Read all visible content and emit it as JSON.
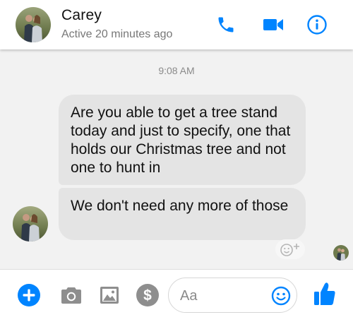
{
  "header": {
    "contact_name": "Carey",
    "status": "Active 20 minutes ago"
  },
  "conversation": {
    "timestamp": "9:08 AM",
    "messages": [
      {
        "sender": "Carey",
        "text": "Are you able to get a tree stand today and just to specify, one that holds our Christmas tree and not one to hunt in"
      },
      {
        "sender": "Carey",
        "text": "We don't need any more of those"
      }
    ]
  },
  "composer": {
    "placeholder": "Aa"
  },
  "icons": {
    "call": "phone-icon",
    "video": "video-camera-icon",
    "info": "info-icon",
    "plus": "plus-icon",
    "camera": "camera-icon",
    "gallery": "image-icon",
    "payment": "dollar-icon",
    "emoji": "smiley-icon",
    "like": "thumbs-up-icon",
    "reaction": "add-reaction-icon"
  },
  "colors": {
    "accent": "#0084ff",
    "bubble": "#e4e4e4",
    "background": "#f2f2f2",
    "muted_icon": "#8e8e8e"
  }
}
